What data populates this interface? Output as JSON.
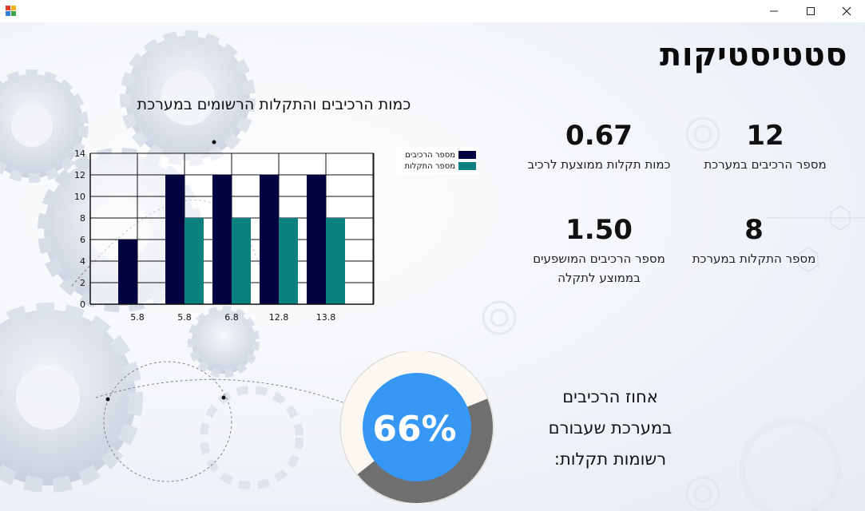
{
  "window": {
    "minimize_icon": "minimize-icon",
    "maximize_icon": "maximize-icon",
    "close_icon": "close-icon"
  },
  "page": {
    "title": "סטטיסטיקות"
  },
  "chart_title": "כמות הרכיבים והתקלות הרשומים במערכת",
  "stats": {
    "components": {
      "value": "12",
      "label": "מספר הרכיבים במערכת"
    },
    "avg_faults": {
      "value": "0.67",
      "label": "כמות תקלות ממוצעת לרכיב"
    },
    "faults": {
      "value": "8",
      "label": "מספר התקלות במערכת"
    },
    "avg_affected": {
      "value": "1.50",
      "label_line1": "מספר הרכיבים המושפעים",
      "label_line2": "בממוצע לתקלה"
    }
  },
  "percent": {
    "value": "66%",
    "fraction": 0.66,
    "text_line1": "אחוז הרכיבים",
    "text_line2": "במערכת שעבורם",
    "text_line3": "רשומות תקלות:",
    "colors": {
      "fill": "#6f6f6f",
      "rest": "#faf8f0",
      "center": "#3797f5"
    }
  },
  "chart_data": {
    "type": "bar",
    "categories": [
      "5.8",
      "5.8",
      "6.8",
      "12.8",
      "13.8"
    ],
    "series": [
      {
        "name": "מספר הרכיבים",
        "values": [
          6,
          12,
          12,
          12,
          12
        ],
        "color": "#03043f"
      },
      {
        "name": "מספר התקלות",
        "values": [
          0,
          8,
          8,
          8,
          8
        ],
        "color": "#0a8080"
      }
    ],
    "ylim": [
      0,
      14
    ],
    "yticks": [
      "0",
      "2",
      "4",
      "6",
      "8",
      "10",
      "12",
      "14"
    ],
    "grid": true,
    "legend": "top-right"
  }
}
